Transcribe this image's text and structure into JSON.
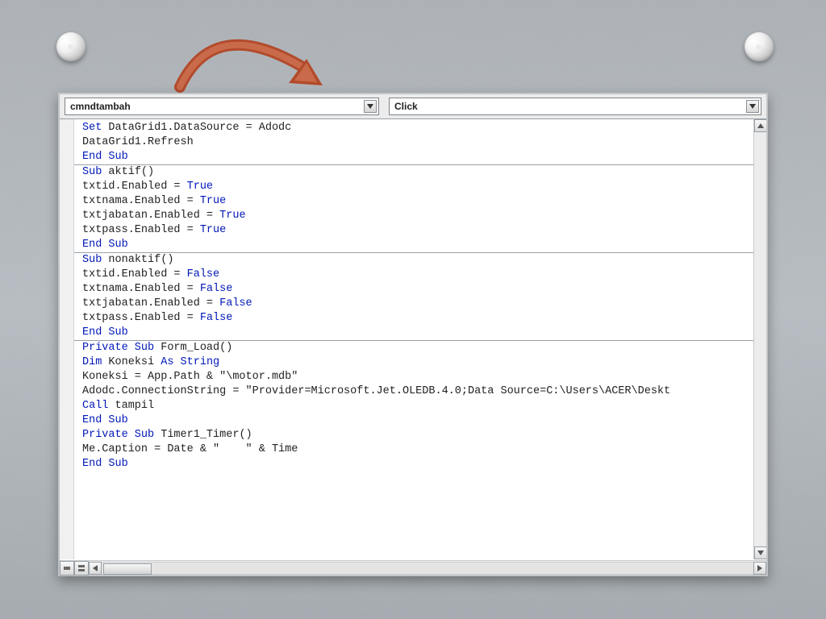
{
  "dropdowns": {
    "object": "cmndtambah",
    "procedure": "Click"
  },
  "arrow": {
    "color": "#b24b2c"
  },
  "code": {
    "block1": [
      {
        "t": "Set",
        "c": "kw",
        "tail": " DataGrid1.DataSource = Adodc"
      },
      {
        "t": "",
        "tail": "DataGrid1.Refresh"
      },
      {
        "t": "End Sub",
        "c": "kw"
      }
    ],
    "block2": [
      {
        "segs": [
          {
            "t": "Sub",
            "c": "kw"
          },
          {
            "t": " aktif()"
          }
        ]
      },
      {
        "segs": [
          {
            "t": "txtid.Enabled = "
          },
          {
            "t": "True",
            "c": "bool"
          }
        ]
      },
      {
        "segs": [
          {
            "t": "txtnama.Enabled = "
          },
          {
            "t": "True",
            "c": "bool"
          }
        ]
      },
      {
        "segs": [
          {
            "t": "txtjabatan.Enabled = "
          },
          {
            "t": "True",
            "c": "bool"
          }
        ]
      },
      {
        "segs": [
          {
            "t": "txtpass.Enabled = "
          },
          {
            "t": "True",
            "c": "bool"
          }
        ]
      },
      {
        "segs": [
          {
            "t": "End Sub",
            "c": "kw"
          }
        ]
      }
    ],
    "block3": [
      {
        "segs": [
          {
            "t": "Sub",
            "c": "kw"
          },
          {
            "t": " nonaktif()"
          }
        ]
      },
      {
        "segs": [
          {
            "t": "txtid.Enabled = "
          },
          {
            "t": "False",
            "c": "bool"
          }
        ]
      },
      {
        "segs": [
          {
            "t": "txtnama.Enabled = "
          },
          {
            "t": "False",
            "c": "bool"
          }
        ]
      },
      {
        "segs": [
          {
            "t": "txtjabatan.Enabled = "
          },
          {
            "t": "False",
            "c": "bool"
          }
        ]
      },
      {
        "segs": [
          {
            "t": "txtpass.Enabled = "
          },
          {
            "t": "False",
            "c": "bool"
          }
        ]
      },
      {
        "segs": [
          {
            "t": "End Sub",
            "c": "kw"
          }
        ]
      }
    ],
    "block4": [
      {
        "segs": [
          {
            "t": "Private Sub",
            "c": "kw"
          },
          {
            "t": " Form_Load()"
          }
        ]
      },
      {
        "segs": [
          {
            "t": "Dim",
            "c": "kw"
          },
          {
            "t": " Koneksi "
          },
          {
            "t": "As String",
            "c": "kw"
          }
        ]
      },
      {
        "segs": [
          {
            "t": "Koneksi = App.Path & \"\\motor.mdb\""
          }
        ]
      },
      {
        "segs": [
          {
            "t": "Adodc.ConnectionString = \"Provider=Microsoft.Jet.OLEDB.4.0;Data Source=C:\\Users\\ACER\\Deskt"
          }
        ]
      },
      {
        "segs": [
          {
            "t": "Call",
            "c": "kw"
          },
          {
            "t": " tampil"
          }
        ]
      },
      {
        "segs": [
          {
            "t": "End Sub",
            "c": "kw"
          }
        ]
      },
      {
        "segs": [
          {
            "t": ""
          }
        ]
      },
      {
        "segs": [
          {
            "t": "Private Sub",
            "c": "kw"
          },
          {
            "t": " Timer1_Timer()"
          }
        ]
      },
      {
        "segs": [
          {
            "t": "Me.Caption = Date & \"    \" & Time"
          }
        ]
      },
      {
        "segs": [
          {
            "t": "End Sub",
            "c": "kw"
          }
        ]
      }
    ]
  }
}
